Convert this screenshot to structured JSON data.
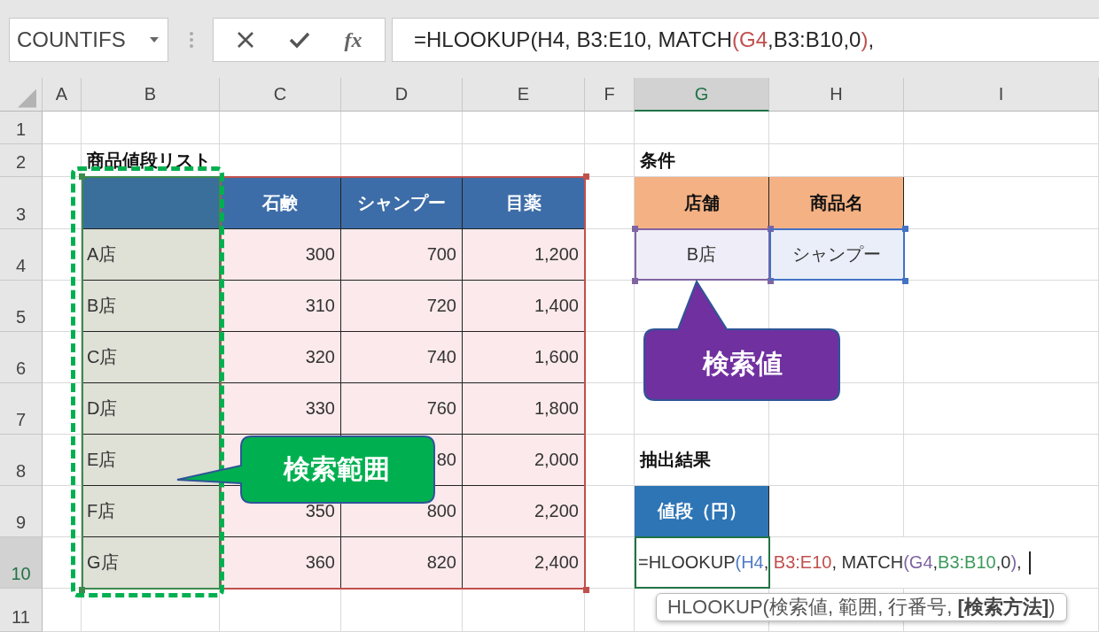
{
  "name_box": "COUNTIFS",
  "formula_bar": {
    "function_button": "fx",
    "segments": [
      {
        "text": "=HLOOKUP(H4, B3:E10, MATCH"
      },
      {
        "text": "(G4",
        "color": "#c0504d"
      },
      {
        "text": ",B3:B10,0"
      },
      {
        "text": ")",
        "color": "#c0504d"
      },
      {
        "text": ","
      }
    ]
  },
  "column_headers": [
    {
      "label": "A",
      "selected": false
    },
    {
      "label": "B",
      "selected": false
    },
    {
      "label": "C",
      "selected": false
    },
    {
      "label": "D",
      "selected": false
    },
    {
      "label": "E",
      "selected": false
    },
    {
      "label": "F",
      "selected": false
    },
    {
      "label": "G",
      "selected": true
    },
    {
      "label": "H",
      "selected": false
    },
    {
      "label": "I",
      "selected": false
    }
  ],
  "row_headers": [
    {
      "label": "1",
      "selected": false
    },
    {
      "label": "2",
      "selected": false
    },
    {
      "label": "3",
      "selected": false
    },
    {
      "label": "4",
      "selected": false
    },
    {
      "label": "5",
      "selected": false
    },
    {
      "label": "6",
      "selected": false
    },
    {
      "label": "7",
      "selected": false
    },
    {
      "label": "8",
      "selected": false
    },
    {
      "label": "9",
      "selected": false
    },
    {
      "label": "10",
      "selected": true
    },
    {
      "label": "11",
      "selected": false
    }
  ],
  "price_list": {
    "title": "商品値段リスト",
    "headers": [
      "石鹸",
      "シャンプー",
      "目薬"
    ],
    "rows": [
      {
        "store": "A店",
        "soap": "300",
        "shampoo": "700",
        "eye_drops": "1,200"
      },
      {
        "store": "B店",
        "soap": "310",
        "shampoo": "720",
        "eye_drops": "1,400"
      },
      {
        "store": "C店",
        "soap": "320",
        "shampoo": "740",
        "eye_drops": "1,600"
      },
      {
        "store": "D店",
        "soap": "330",
        "shampoo": "760",
        "eye_drops": "1,800"
      },
      {
        "store": "E店",
        "shampoo": "80",
        "eye_drops": "2,000"
      },
      {
        "store": "F店",
        "soap": "350",
        "shampoo": "800",
        "eye_drops": "2,200"
      },
      {
        "store": "G店",
        "soap": "360",
        "shampoo": "820",
        "eye_drops": "2,400"
      }
    ]
  },
  "conditions": {
    "title": "条件",
    "headers": [
      "店舗",
      "商品名"
    ],
    "values": [
      "B店",
      "シャンプー"
    ]
  },
  "result": {
    "title": "抽出結果",
    "header": "値段（円）",
    "editor_segments": [
      {
        "text": "=HLOOKUP"
      },
      {
        "text": "(H4",
        "color": "#4f7ac6"
      },
      {
        "text": ", "
      },
      {
        "text": "B3:E10",
        "color": "#c0504d"
      },
      {
        "text": ", MATCH"
      },
      {
        "text": "(G4",
        "color": "#8064a2"
      },
      {
        "text": ","
      },
      {
        "text": "B3:B10",
        "color": "#3c9a5c"
      },
      {
        "text": ",0"
      },
      {
        "text": ")",
        "color": "#8064a2"
      },
      {
        "text": ","
      }
    ]
  },
  "tooltip": "HLOOKUP(検索値, 範囲, 行番号, **[検索方法]**)",
  "callouts": [
    {
      "text": "検索値",
      "color": "#7030a0"
    },
    {
      "text": "検索範囲",
      "color": "#00b050"
    }
  ]
}
